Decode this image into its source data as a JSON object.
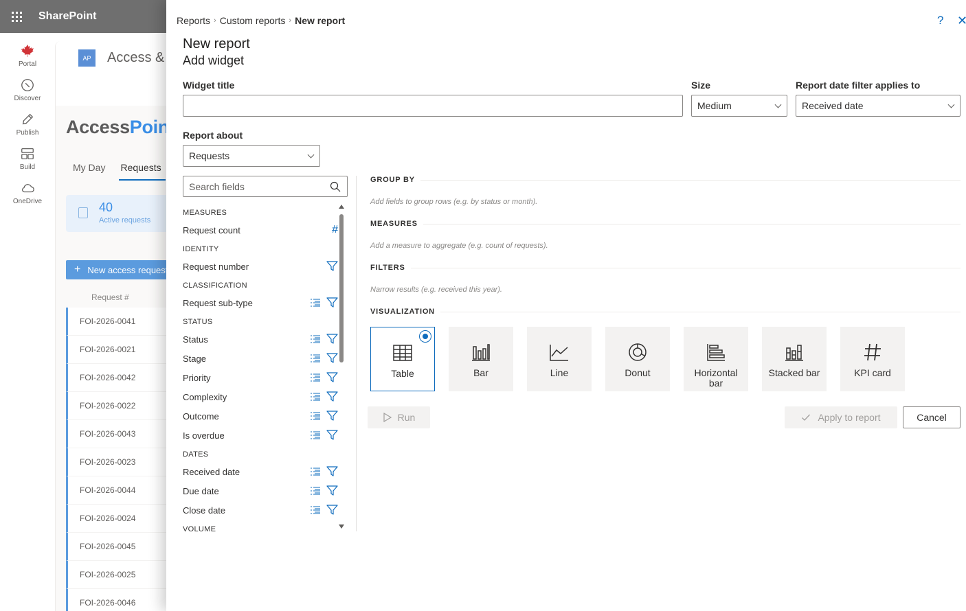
{
  "suite": {
    "title": "SharePoint"
  },
  "appbar": [
    {
      "label": "Portal",
      "icon": "maple-leaf-icon"
    },
    {
      "label": "Discover",
      "icon": "compass-icon"
    },
    {
      "label": "Publish",
      "icon": "pen-icon"
    },
    {
      "label": "Build",
      "icon": "grid-icon"
    },
    {
      "label": "OneDrive",
      "icon": "cloud-icon"
    }
  ],
  "background": {
    "logo": "AP",
    "site_name": "Access &",
    "brand_a": "Access",
    "brand_b": "Point",
    "tabs": [
      "My Day",
      "Requests"
    ],
    "kpi_value": "40",
    "kpi_label": "Active requests",
    "new_button": "New access request",
    "column_header": "Request #",
    "rows": [
      "FOI-2026-0041",
      "FOI-2026-0021",
      "FOI-2026-0042",
      "FOI-2026-0022",
      "FOI-2026-0043",
      "FOI-2026-0023",
      "FOI-2026-0044",
      "FOI-2026-0024",
      "FOI-2026-0045",
      "FOI-2026-0025",
      "FOI-2026-0046"
    ]
  },
  "breadcrumb": [
    "Reports",
    "Custom reports",
    "New report"
  ],
  "header": {
    "title": "New report",
    "subtitle": "Add widget",
    "help": "?",
    "close": "✕"
  },
  "form": {
    "widget_title_label": "Widget title",
    "widget_title_value": "",
    "size_label": "Size",
    "size_value": "Medium",
    "date_filter_label": "Report date filter applies to",
    "date_filter_value": "Received date",
    "report_about_label": "Report about",
    "report_about_value": "Requests"
  },
  "fields": {
    "search_placeholder": "Search fields",
    "groups": [
      {
        "name": "MEASURES",
        "items": [
          {
            "label": "Request count",
            "kind": "measure"
          }
        ]
      },
      {
        "name": "IDENTITY",
        "items": [
          {
            "label": "Request number",
            "kind": "filter"
          }
        ]
      },
      {
        "name": "CLASSIFICATION",
        "items": [
          {
            "label": "Request sub-type",
            "kind": "both"
          }
        ]
      },
      {
        "name": "STATUS",
        "items": [
          {
            "label": "Status",
            "kind": "both"
          },
          {
            "label": "Stage",
            "kind": "both"
          },
          {
            "label": "Priority",
            "kind": "both"
          },
          {
            "label": "Complexity",
            "kind": "both"
          },
          {
            "label": "Outcome",
            "kind": "both"
          },
          {
            "label": "Is overdue",
            "kind": "both"
          }
        ]
      },
      {
        "name": "DATES",
        "items": [
          {
            "label": "Received date",
            "kind": "both"
          },
          {
            "label": "Due date",
            "kind": "both"
          },
          {
            "label": "Close date",
            "kind": "both"
          }
        ]
      },
      {
        "name": "VOLUME",
        "items": []
      }
    ]
  },
  "config": {
    "group_by": {
      "title": "GROUP BY",
      "hint": "Add fields to group rows (e.g. by status or month)."
    },
    "measures": {
      "title": "MEASURES",
      "hint": "Add a measure to aggregate (e.g. count of requests)."
    },
    "filters": {
      "title": "FILTERS",
      "hint": "Narrow results (e.g. received this year)."
    },
    "visualization": {
      "title": "VISUALIZATION"
    }
  },
  "visualizations": [
    {
      "label": "Table",
      "icon": "table-icon",
      "selected": true
    },
    {
      "label": "Bar",
      "icon": "bar-chart-icon",
      "selected": false
    },
    {
      "label": "Line",
      "icon": "line-chart-icon",
      "selected": false
    },
    {
      "label": "Donut",
      "icon": "donut-chart-icon",
      "selected": false
    },
    {
      "label": "Horizontal bar",
      "icon": "horizontal-bar-icon",
      "selected": false
    },
    {
      "label": "Stacked bar",
      "icon": "stacked-bar-icon",
      "selected": false
    },
    {
      "label": "KPI card",
      "icon": "hash-icon",
      "selected": false
    }
  ],
  "actions": {
    "run": "Run",
    "apply": "Apply to report",
    "cancel": "Cancel"
  },
  "colors": {
    "accent": "#0f6cbd",
    "suitebar": "#6f6f6f"
  }
}
